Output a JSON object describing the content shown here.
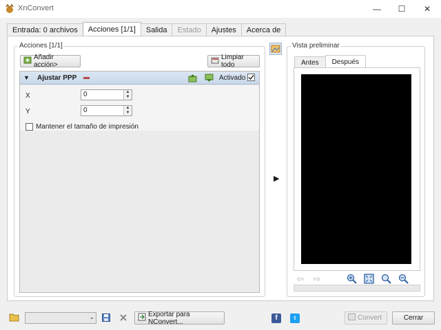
{
  "window": {
    "title": "XnConvert",
    "minimize": "—",
    "maximize": "☐",
    "close": "✕"
  },
  "tabs": [
    {
      "label": "Entrada: 0 archivos",
      "state": "normal"
    },
    {
      "label": "Acciones [1/1]",
      "state": "active"
    },
    {
      "label": "Salida",
      "state": "normal"
    },
    {
      "label": "Estado",
      "state": "disabled"
    },
    {
      "label": "Ajustes",
      "state": "normal"
    },
    {
      "label": "Acerca de",
      "state": "normal"
    }
  ],
  "actions": {
    "group_title": "Acciones [1/1]",
    "add_action": "Añadir acción>",
    "clear_all": "Limpiar todo",
    "action": {
      "title": "Ajustar PPP",
      "enabled_label": "Activado",
      "enabled": true,
      "x_label": "X",
      "x_value": "0",
      "y_label": "Y",
      "y_value": "0",
      "keep_print_size": "Mantener el tamaño de impresión",
      "keep_print_size_checked": false
    }
  },
  "preview": {
    "group_title": "Vista preliminar",
    "tabs": [
      {
        "label": "Antes",
        "active": false
      },
      {
        "label": "Después",
        "active": true
      }
    ]
  },
  "bottom": {
    "combo_value": "",
    "export_label": "Exportar para NConvert...",
    "convert_label": "Convert",
    "close_label": "Cerrar"
  },
  "colors": {
    "accent_header": "#c9d8ea",
    "facebook": "#3b5998",
    "twitter": "#1da1f2"
  }
}
